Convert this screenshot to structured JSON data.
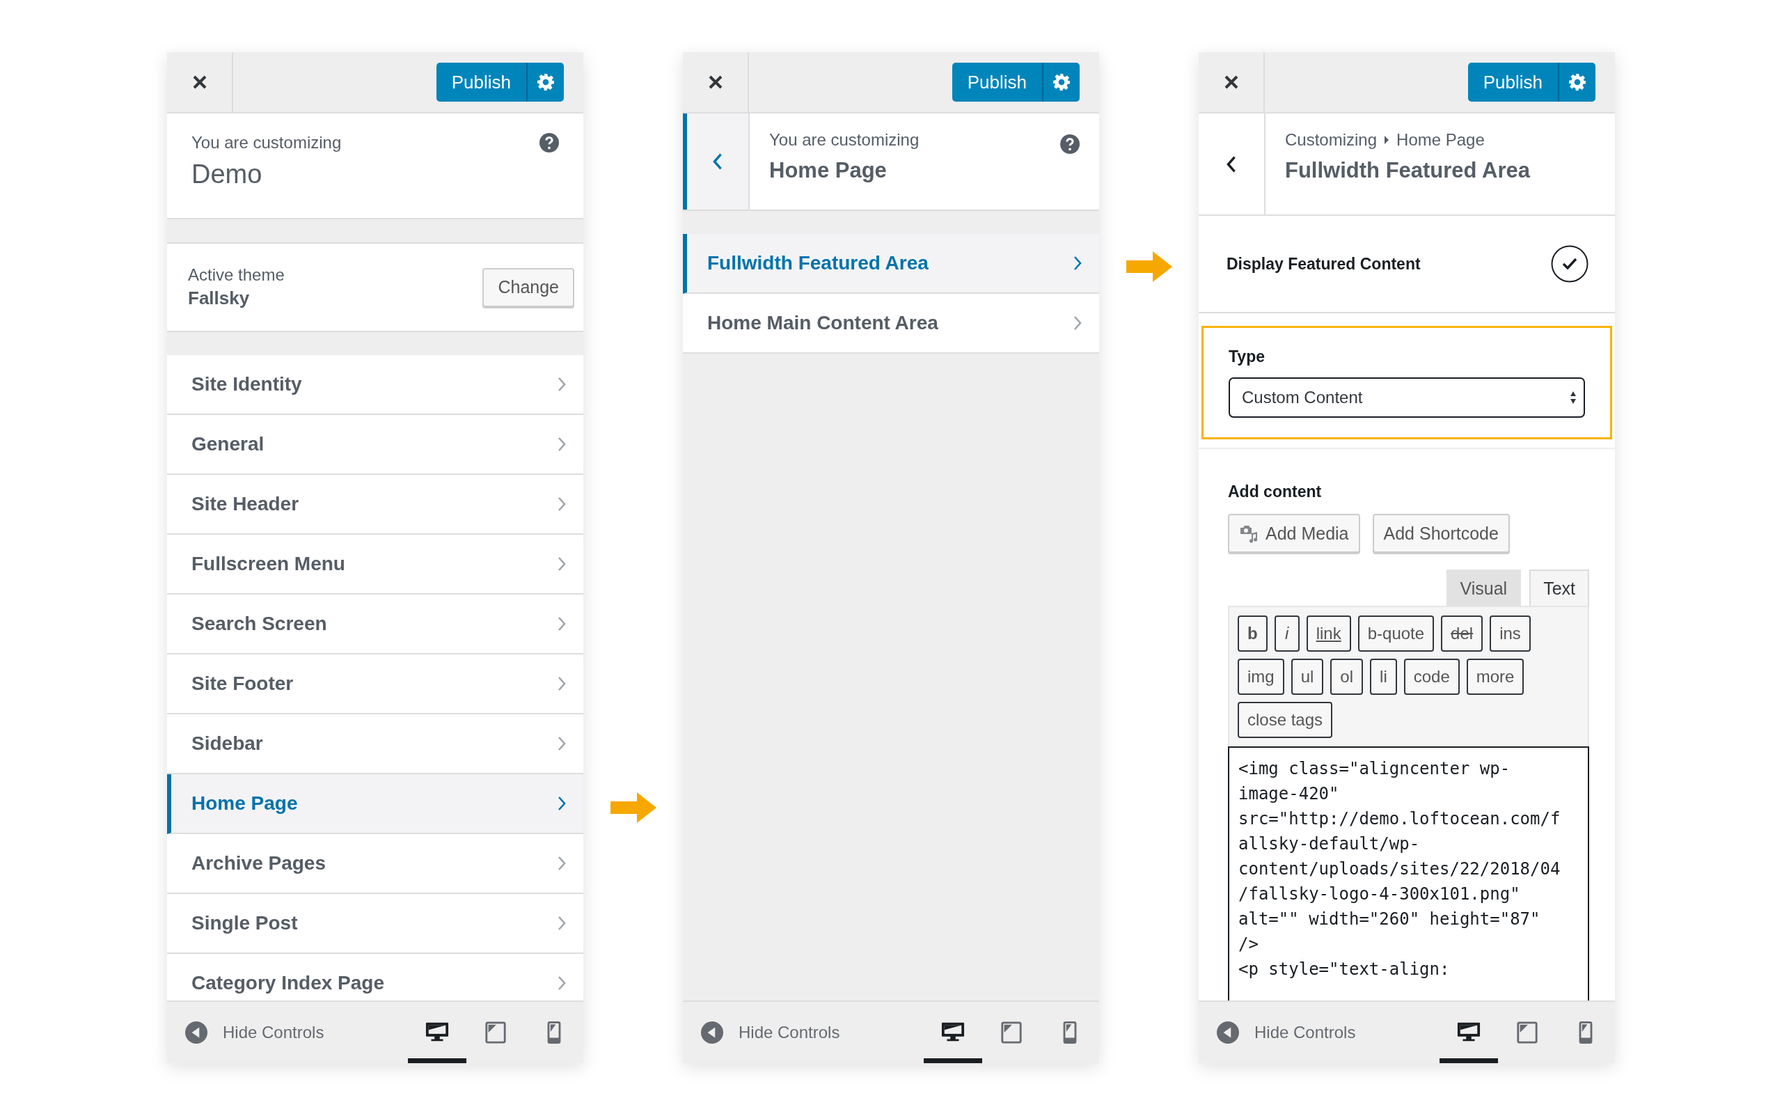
{
  "panels": [
    {
      "kind": "root",
      "header": {
        "publish": "Publish"
      },
      "info": {
        "caption": "You are customizing",
        "title": "Demo"
      },
      "theme": {
        "label": "Active theme",
        "name": "Fallsky",
        "button": "Change"
      },
      "items": [
        {
          "label": "Site Identity",
          "selected": false
        },
        {
          "label": "General",
          "selected": false
        },
        {
          "label": "Site Header",
          "selected": false
        },
        {
          "label": "Fullscreen Menu",
          "selected": false
        },
        {
          "label": "Search Screen",
          "selected": false
        },
        {
          "label": "Site Footer",
          "selected": false
        },
        {
          "label": "Sidebar",
          "selected": false
        },
        {
          "label": "Home Page",
          "selected": true
        },
        {
          "label": "Archive Pages",
          "selected": false
        },
        {
          "label": "Single Post",
          "selected": false
        },
        {
          "label": "Category Index Page",
          "selected": false
        }
      ],
      "footer": {
        "hide_label": "Hide Controls",
        "devices": [
          {
            "kind": "desktop",
            "selected": true
          },
          {
            "kind": "tablet",
            "selected": false
          },
          {
            "kind": "mobile",
            "selected": false
          }
        ]
      }
    },
    {
      "kind": "section",
      "header": {
        "publish": "Publish"
      },
      "info": {
        "caption": "You are customizing",
        "title": "Home Page"
      },
      "items": [
        {
          "label": "Fullwidth Featured Area",
          "selected": true
        },
        {
          "label": "Home Main Content Area",
          "selected": false
        }
      ],
      "footer": {
        "hide_label": "Hide Controls",
        "devices": [
          {
            "kind": "desktop",
            "selected": true
          },
          {
            "kind": "tablet",
            "selected": false
          },
          {
            "kind": "mobile",
            "selected": false
          }
        ]
      }
    },
    {
      "kind": "controls",
      "header": {
        "publish": "Publish"
      },
      "info": {
        "crumbs": [
          "Customizing",
          "Home Page"
        ],
        "title": "Fullwidth Featured Area"
      },
      "toggle": {
        "label": "Display Featured Content",
        "checked": true
      },
      "type_field": {
        "label": "Type",
        "value": "Custom Content",
        "highlighted": true
      },
      "add_content": {
        "label": "Add content",
        "media_button": "Add Media",
        "shortcode_button": "Add Shortcode",
        "tabs": [
          {
            "label": "Visual",
            "selected": false
          },
          {
            "label": "Text",
            "selected": true
          }
        ],
        "quicktags": [
          {
            "label": "b",
            "kind": "bold"
          },
          {
            "label": "i",
            "kind": "italic"
          },
          {
            "label": "link",
            "kind": "link"
          },
          {
            "label": "b-quote",
            "kind": "plain"
          },
          {
            "label": "del",
            "kind": "strike"
          },
          {
            "label": "ins",
            "kind": "plain"
          },
          {
            "label": "img",
            "kind": "plain"
          },
          {
            "label": "ul",
            "kind": "plain"
          },
          {
            "label": "ol",
            "kind": "plain"
          },
          {
            "label": "li",
            "kind": "plain"
          },
          {
            "label": "code",
            "kind": "plain"
          },
          {
            "label": "more",
            "kind": "plain"
          },
          {
            "label": "close tags",
            "kind": "plain"
          }
        ],
        "code_lines": [
          "<img class=\"aligncenter wp-",
          "image-420\"",
          "src=\"http://demo.loftocean.com/f",
          "allsky-default/wp-",
          "content/uploads/sites/22/2018/04",
          "/fallsky-logo-4-300x101.png\"",
          "alt=\"\" width=\"260\" height=\"87\"",
          "/>",
          "<p style=\"text-align:"
        ]
      },
      "footer": {
        "hide_label": "Hide Controls",
        "devices": [
          {
            "kind": "desktop",
            "selected": true
          },
          {
            "kind": "tablet",
            "selected": false
          },
          {
            "kind": "mobile",
            "selected": false
          }
        ]
      }
    }
  ]
}
